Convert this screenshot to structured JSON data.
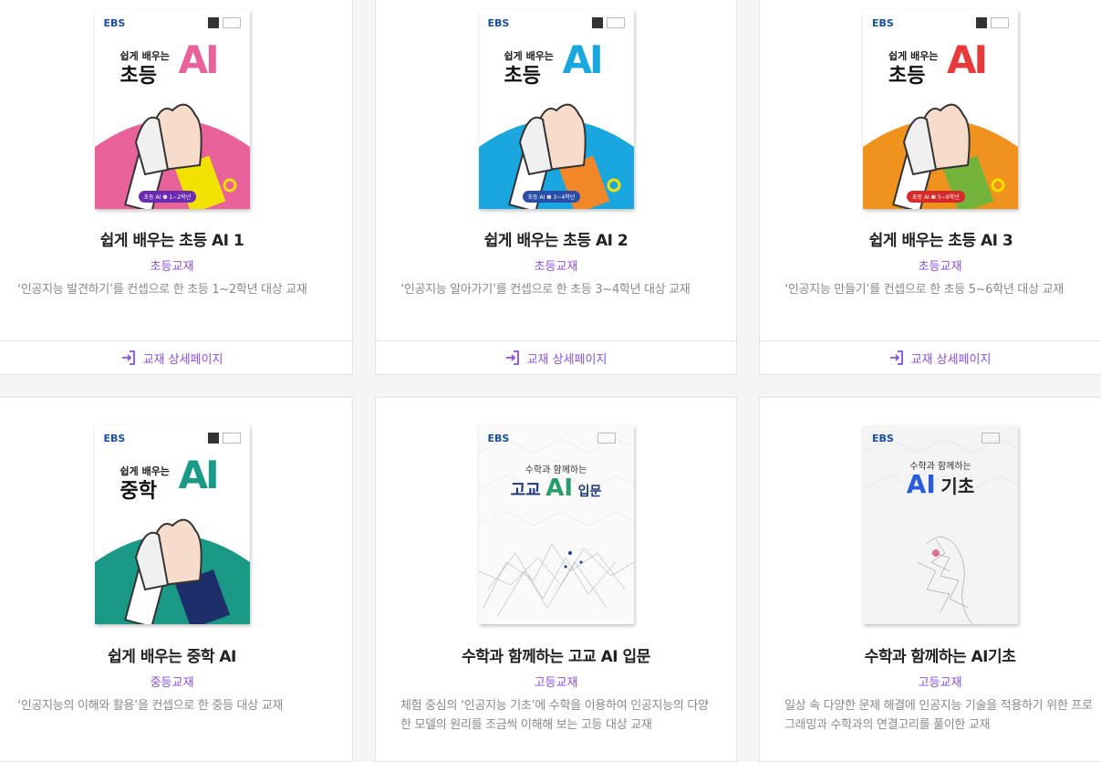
{
  "cards": [
    {
      "title": "쉽게 배우는 초등 AI 1",
      "category": "초등교재",
      "description": "‘인공지능 발견하기’를 컨셉으로 한 초등 1~2학년 대상 교재",
      "link_label": "교재 상세페이지",
      "cover": {
        "publisher": "EBS",
        "series": "쉽게 배우는",
        "level": "초등",
        "ai": "AI",
        "badge": "초등 AI ❶ 1~2학년",
        "accent": "#e8619b",
        "sleeve": "#f2e200"
      }
    },
    {
      "title": "쉽게 배우는 초등 AI 2",
      "category": "초등교재",
      "description": "‘인공지능 알아가기’를 컨셉으로 한 초등 3~4학년 대상 교재",
      "link_label": "교재 상세페이지",
      "cover": {
        "publisher": "EBS",
        "series": "쉽게 배우는",
        "level": "초등",
        "ai": "AI",
        "badge": "초등 AI ❷ 3~4학년",
        "accent": "#1aa7e0",
        "sleeve": "#f2872a"
      }
    },
    {
      "title": "쉽게 배우는 초등 AI 3",
      "category": "초등교재",
      "description": "‘인공지능 만들기’를 컨셉으로 한 초등 5~6학년 대상 교재",
      "link_label": "교재 상세페이지",
      "cover": {
        "publisher": "EBS",
        "series": "쉽게 배우는",
        "level": "초등",
        "ai": "AI",
        "badge": "초등 AI ❸ 5~6학년",
        "accent": "#f0921e",
        "sleeve": "#72b43a"
      }
    },
    {
      "title": "쉽게 배우는 중학 AI",
      "category": "중등교재",
      "description": "‘인공지능의 이해와 활용’을 컨셉으로 한 중등 대상 교재",
      "link_label": "",
      "cover": {
        "publisher": "EBS",
        "series": "쉽게 배우는",
        "level": "중학",
        "ai": "AI",
        "badge": "",
        "accent": "#1a9a86",
        "sleeve": "#1d2f6b"
      }
    },
    {
      "title": "수학과 함께하는 고교 AI 입문",
      "category": "고등교재",
      "description": "체험 중심의 ‘인공지능 기초’에 수학을 이용하여 인공지능의 다양한 모델의 원리를 조금씩 이해해 보는 고등 대상 교재",
      "link_label": "",
      "cover": {
        "publisher": "EBS",
        "series": "수학과 함께하는",
        "level": "고교",
        "ai": "AI",
        "suffix": "입문",
        "accent": "#2a9d6a"
      }
    },
    {
      "title": "수학과 함께하는 AI기초",
      "category": "고등교재",
      "description": "일상 속 다양한 문제 해결에 인공지능 기술을 적용하기 위한 프로그래밍과 수학과의 연결고리를 풀이한 교재",
      "link_label": "",
      "cover": {
        "publisher": "EBS",
        "series": "수학과 함께하는",
        "level": "",
        "ai": "AI",
        "suffix": "기초",
        "accent": "#2a5bd8"
      }
    }
  ],
  "colors": {
    "accent": "#8a4fd8",
    "title": "#222222",
    "description": "#888888",
    "border": "#e3e3e3"
  }
}
